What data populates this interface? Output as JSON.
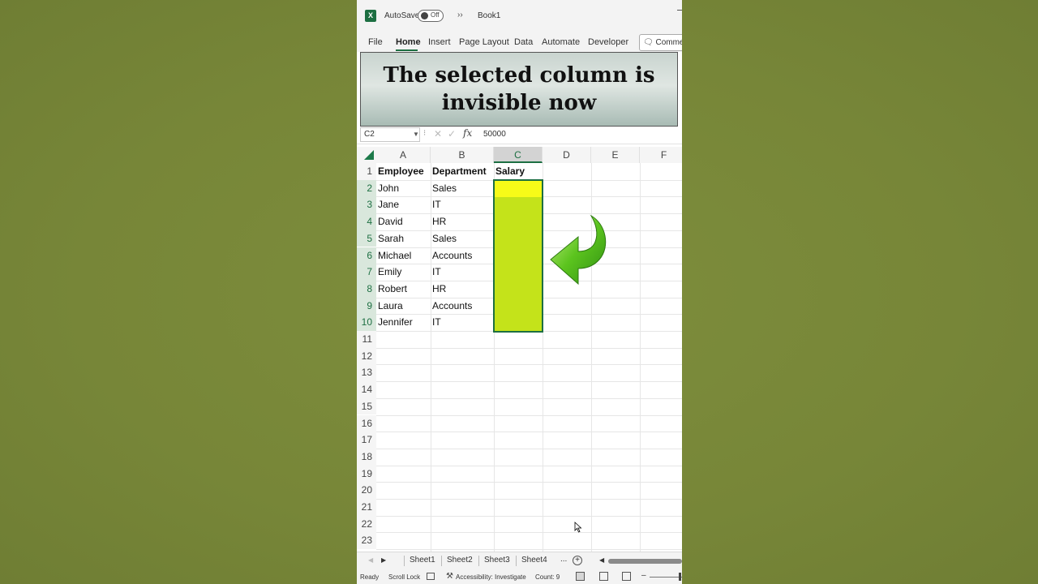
{
  "titlebar": {
    "app_icon": "excel-logo-icon",
    "app_icon_letter": "X",
    "autosave_label": "AutoSave",
    "autosave_state": "Off",
    "more_icon": "double-chevron-right-icon",
    "more_glyph": "››",
    "book_title": "Book1"
  },
  "ribbon": {
    "tabs": [
      "File",
      "Home",
      "Insert",
      "Page Layout",
      "Data",
      "Automate",
      "Developer"
    ],
    "active_tab": "Home",
    "comments_icon": "comment-icon",
    "comments_label": "🗨 Comme"
  },
  "banner": {
    "line1": "The selected column is",
    "line2": "invisible now"
  },
  "formula_bar": {
    "name_box": "C2",
    "fx": "fx",
    "value": "50000"
  },
  "grid": {
    "columns": [
      "A",
      "B",
      "C",
      "D",
      "E",
      "F"
    ],
    "selected_column": "C",
    "rows": [
      "1",
      "2",
      "3",
      "4",
      "5",
      "6",
      "7",
      "8",
      "9",
      "10",
      "11",
      "12",
      "13",
      "14",
      "15",
      "16",
      "17",
      "18",
      "19",
      "20",
      "21",
      "22",
      "23"
    ],
    "selected_rows": [
      "2",
      "3",
      "4",
      "5",
      "6",
      "7",
      "8",
      "9",
      "10"
    ],
    "headers": [
      "Employee",
      "Department",
      "Salary"
    ],
    "data": [
      [
        "John",
        "Sales"
      ],
      [
        "Jane",
        "IT"
      ],
      [
        "David",
        "HR"
      ],
      [
        "Sarah",
        "Sales"
      ],
      [
        "Michael",
        "Accounts"
      ],
      [
        "Emily",
        "IT"
      ],
      [
        "Robert",
        "HR"
      ],
      [
        "Laura",
        "Accounts"
      ],
      [
        "Jennifer",
        "IT"
      ]
    ],
    "highlight_colors": {
      "active_cell": "#f7fb18",
      "selection": "#c4e31a",
      "border": "#1d6f42"
    },
    "annotation_icon": "curved-green-arrow-icon"
  },
  "sheets": {
    "tabs": [
      "Sheet1",
      "Sheet2",
      "Sheet3",
      "Sheet4"
    ],
    "more": "...",
    "add": "+"
  },
  "status_bar": {
    "ready": "Ready",
    "scroll_lock": "Scroll Lock",
    "accessibility": "Accessibility: Investigate",
    "count": "Count: 9",
    "zoom_minus": "–"
  },
  "colors": {
    "accent": "#1d6f42",
    "background": "#7b8a3a"
  }
}
